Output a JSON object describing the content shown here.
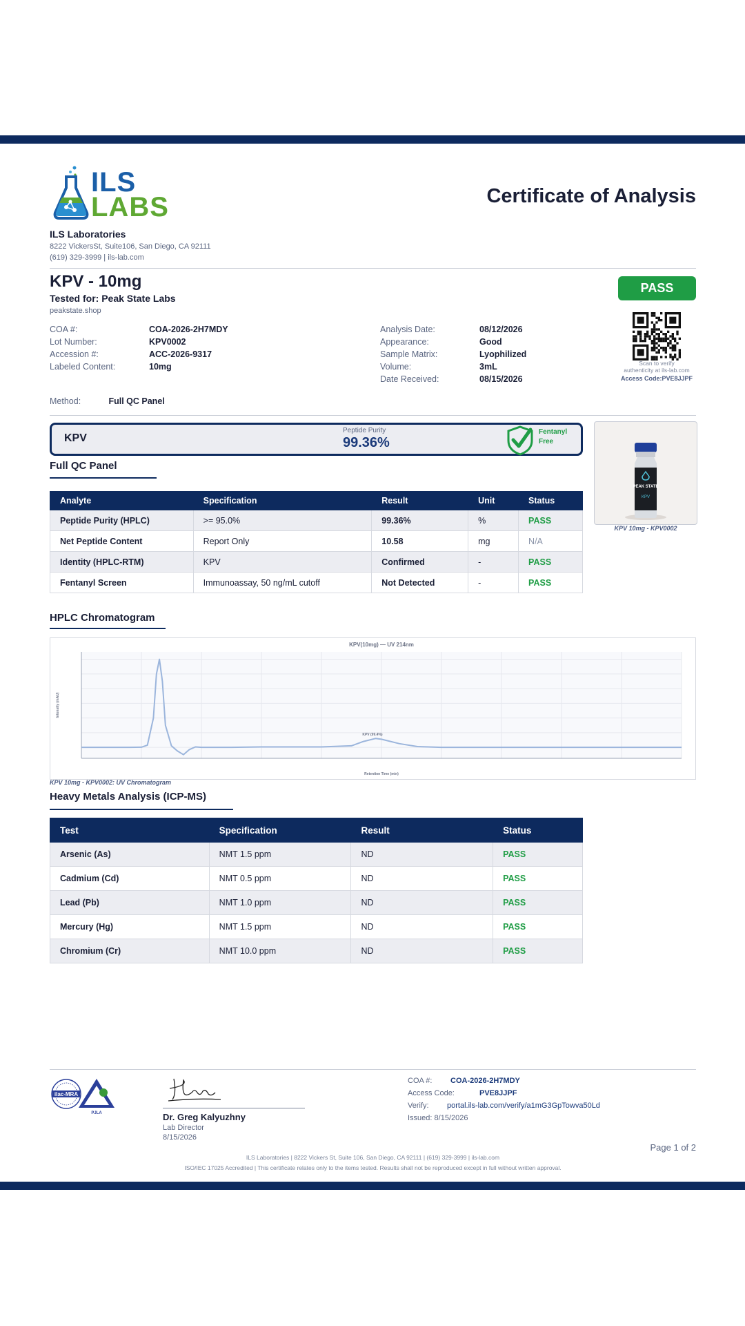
{
  "header": {
    "logo_top": "ILS",
    "logo_bottom": "LABS",
    "title": "Certificate of Analysis",
    "lab_name": "ILS Laboratories",
    "address": "8222 VickersSt, Suite106, San Diego, CA 92111",
    "contact": "(619) 329-3999 | ils-lab.com"
  },
  "product": {
    "title": "KPV - 10mg",
    "tested_for": "Tested for: Peak State Labs",
    "client_site": "peakstate.shop",
    "status": "PASS"
  },
  "meta_left": [
    {
      "label": "COA #:",
      "value": "COA-2026-2H7MDY"
    },
    {
      "label": "Lot Number:",
      "value": "KPV0002"
    },
    {
      "label": "Accession #:",
      "value": "ACC-2026-9317"
    },
    {
      "label": "Labeled Content:",
      "value": "10mg"
    }
  ],
  "meta_right": [
    {
      "label": "Analysis Date:",
      "value": "08/12/2026"
    },
    {
      "label": "Appearance:",
      "value": "Good"
    },
    {
      "label": "Sample Matrix:",
      "value": "Lyophilized"
    },
    {
      "label": "Volume:",
      "value": "3mL"
    },
    {
      "label": "Date Received:",
      "value": "08/15/2026"
    }
  ],
  "qr": {
    "caption1": "Scan to verify",
    "caption2": "authenticity at ils-lab.com",
    "access": "Access Code:PVE8JJPF"
  },
  "method": {
    "label": "Method:",
    "value": "Full QC Panel"
  },
  "purity": {
    "name": "KPV",
    "label": "Peptide Purity",
    "value": "99.36%",
    "badge_line1": "Fentanyl",
    "badge_line2": "Free"
  },
  "vial": {
    "caption": "KPV 10mg - KPV0002",
    "label_brand": "PEAK STATE",
    "label_product": "KPV"
  },
  "qc_panel": {
    "title": "Full QC Panel",
    "headers": [
      "Analyte",
      "Specification",
      "Result",
      "Unit",
      "Status"
    ],
    "rows": [
      [
        "Peptide Purity (HPLC)",
        ">= 95.0%",
        "99.36%",
        "%",
        "PASS"
      ],
      [
        "Net Peptide Content",
        "Report Only",
        "10.58",
        "mg",
        "N/A"
      ],
      [
        "Identity (HPLC-RTM)",
        "KPV",
        "Confirmed",
        "-",
        "PASS"
      ],
      [
        "Fentanyl Screen",
        "Immunoassay, 50 ng/mL cutoff",
        "Not Detected",
        "-",
        "PASS"
      ]
    ]
  },
  "chromatogram": {
    "section_title": "HPLC Chromatogram",
    "caption": "KPV 10mg - KPV0002: UV Chromatogram"
  },
  "chart_data": {
    "type": "line",
    "title": "KPV(10mg) — UV 214nm",
    "xlabel": "Retention Time (min)",
    "ylabel": "Intensity (mAU)",
    "series": [
      {
        "x": [
          0,
          0.8,
          1.0,
          1.1,
          1.2,
          1.25,
          1.3,
          1.35,
          1.4,
          1.5,
          1.6,
          1.7,
          1.8,
          1.9,
          2.0,
          2.5,
          3.0,
          4.0,
          4.5,
          4.7,
          4.9,
          5.0,
          5.3,
          5.6,
          6.0,
          7.0,
          8.0,
          9.0,
          10.0
        ],
        "y": [
          0,
          0,
          2,
          30,
          400,
          1000,
          1200,
          900,
          300,
          20,
          -50,
          -100,
          -30,
          5,
          0,
          0,
          5,
          5,
          20,
          80,
          120,
          110,
          50,
          10,
          0,
          0,
          0,
          0,
          0
        ]
      }
    ],
    "xlim": [
      0,
      10
    ],
    "ylim": [
      -150,
      1300
    ],
    "grid": true,
    "annotations": [
      {
        "text": "KPV (99.4%)",
        "x": 4.85,
        "y": 160
      }
    ]
  },
  "heavy_metals": {
    "title": "Heavy Metals Analysis (ICP-MS)",
    "headers": [
      "Test",
      "Specification",
      "Result",
      "Status"
    ],
    "rows": [
      [
        "Arsenic (As)",
        "NMT 1.5 ppm",
        "ND",
        "PASS"
      ],
      [
        "Cadmium (Cd)",
        "NMT 0.5 ppm",
        "ND",
        "PASS"
      ],
      [
        "Lead (Pb)",
        "NMT 1.0 ppm",
        "ND",
        "PASS"
      ],
      [
        "Mercury (Hg)",
        "NMT 1.5 ppm",
        "ND",
        "PASS"
      ],
      [
        "Chromium (Cr)",
        "NMT 10.0 ppm",
        "ND",
        "PASS"
      ]
    ]
  },
  "accreditation": {
    "ilac": "ilac-MRA",
    "pjla": "PJLA"
  },
  "signature": {
    "name": "Dr. Greg Kalyuzhny",
    "role": "Lab Director",
    "date": "8/15/2026"
  },
  "footer_meta": [
    {
      "label": "COA #:",
      "value": "COA-2026-2H7MDY",
      "bold": true
    },
    {
      "label": "Access Code:",
      "value": "PVE8JJPF",
      "bold": true
    },
    {
      "label": "Verify:",
      "value": "portal.ils-lab.com/verify/a1mG3GpTowva50Ld",
      "bold": false
    },
    {
      "label": "Issued: 8/15/2026",
      "value": "",
      "bold": false
    }
  ],
  "footer": {
    "page": "Page 1 of 2",
    "line1": "ILS Laboratories | 8222 Vickers St, Suite 106, San Diego, CA 92111 | (619) 329-3999 | ils-lab.com",
    "line2": "ISO/IEC 17025 Accredited | This certificate relates only to the items tested. Results shall not be reproduced except in full without written approval."
  },
  "colors": {
    "navy": "#0d2a5e",
    "pass_green": "#1f9d45",
    "logo_blue": "#1b5fa8",
    "logo_green": "#5fa833",
    "trace": "#9bb5dc"
  }
}
